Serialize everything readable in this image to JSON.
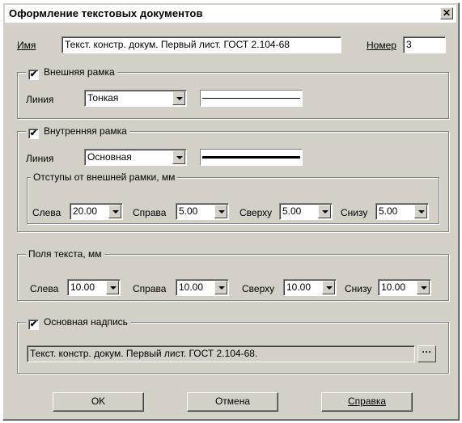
{
  "window": {
    "title": "Оформление текстовых документов",
    "close_label": "✕"
  },
  "name_row": {
    "name_label": "Имя",
    "name_value": "Текст. констр. докум. Первый лист. ГОСТ 2.104-68",
    "number_label": "Номер",
    "number_value": "3"
  },
  "outer_frame": {
    "title": "Внешняя рамка",
    "checked": "✔",
    "line_label": "Линия",
    "line_value": "Тонкая"
  },
  "inner_frame": {
    "title": "Внутренняя рамка",
    "checked": "✔",
    "line_label": "Линия",
    "line_value": "Основная",
    "offsets": {
      "title": "Отступы от внешней рамки, мм",
      "left_label": "Слева",
      "left_value": "20.00",
      "right_label": "Справа",
      "right_value": "5.00",
      "top_label": "Сверху",
      "top_value": "5.00",
      "bottom_label": "Снизу",
      "bottom_value": "5.00"
    }
  },
  "text_margins": {
    "title": "Поля текста, мм",
    "left_label": "Слева",
    "left_value": "10.00",
    "right_label": "Справа",
    "right_value": "10.00",
    "top_label": "Сверху",
    "top_value": "10.00",
    "bottom_label": "Снизу",
    "bottom_value": "10.00"
  },
  "title_block": {
    "title": "Основная надпись",
    "checked": "✔",
    "value": "Текст. констр. докум. Первый лист. ГОСТ 2.104-68.",
    "browse_label": "···"
  },
  "buttons": {
    "ok": "OK",
    "cancel": "Отмена",
    "help": "Справка"
  }
}
